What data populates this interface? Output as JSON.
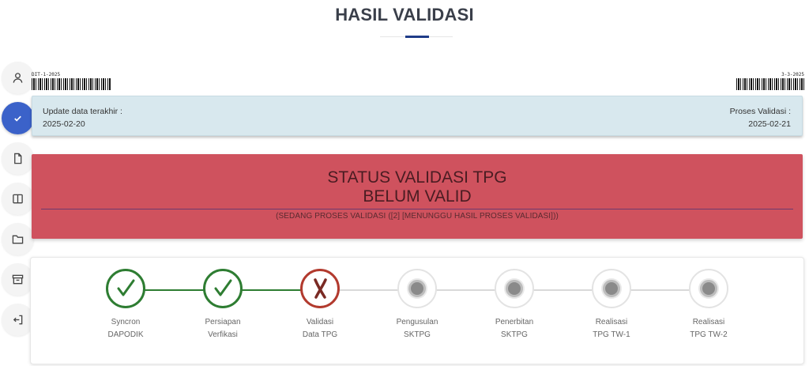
{
  "page": {
    "title": "HASIL VALIDASI"
  },
  "rail": [
    {
      "icon": "user-icon",
      "active": false
    },
    {
      "icon": "check-icon",
      "active": true
    },
    {
      "icon": "document-icon",
      "active": false
    },
    {
      "icon": "book-icon",
      "active": false
    },
    {
      "icon": "folder-icon",
      "active": false
    },
    {
      "icon": "archive-icon",
      "active": false
    },
    {
      "icon": "logout-icon",
      "active": false
    }
  ],
  "barcodes": {
    "left_text": "DIT-1-2025",
    "right_text": "3-3-2025"
  },
  "info": {
    "update_label": "Update data terakhir :",
    "update_value": "2025-02-20",
    "proses_label": "Proses Validasi :",
    "proses_value": "2025-02-21"
  },
  "status": {
    "title": "STATUS VALIDASI TPG",
    "value": "BELUM VALID",
    "note": "(SEDANG PROSES VALIDASI ([2] [MENUNGGU HASIL PROSES VALIDASI]))",
    "color": "#cf525e"
  },
  "steps": [
    {
      "line1": "Syncron",
      "line2": "DAPODIK",
      "state": "done"
    },
    {
      "line1": "Persiapan",
      "line2": "Verfikasi",
      "state": "done"
    },
    {
      "line1": "Validasi",
      "line2": "Data TPG",
      "state": "fail"
    },
    {
      "line1": "Pengusulan",
      "line2": "SKTPG",
      "state": "pending"
    },
    {
      "line1": "Penerbitan",
      "line2": "SKTPG",
      "state": "pending"
    },
    {
      "line1": "Realisasi",
      "line2": "TPG TW-1",
      "state": "pending"
    },
    {
      "line1": "Realisasi",
      "line2": "TPG TW-2",
      "state": "pending"
    }
  ],
  "colors": {
    "done": "#2e7d32",
    "fail": "#b23a2e",
    "pending": "#8a8a8a",
    "accent": "#3b62c9"
  }
}
